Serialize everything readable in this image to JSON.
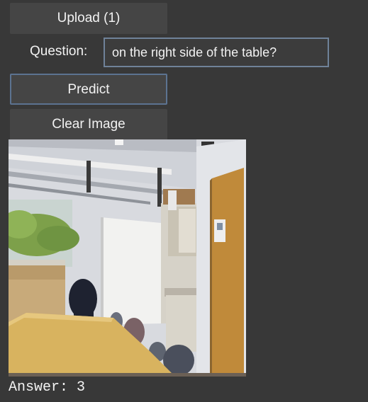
{
  "upload": {
    "label": "Upload (1)"
  },
  "question": {
    "label": "Question:",
    "value": "on the right side of the table?"
  },
  "predict": {
    "label": "Predict"
  },
  "clear": {
    "label": "Clear Image"
  },
  "image": {
    "icon": "uploaded-photo"
  },
  "answer": {
    "text": "Answer: 3"
  }
}
